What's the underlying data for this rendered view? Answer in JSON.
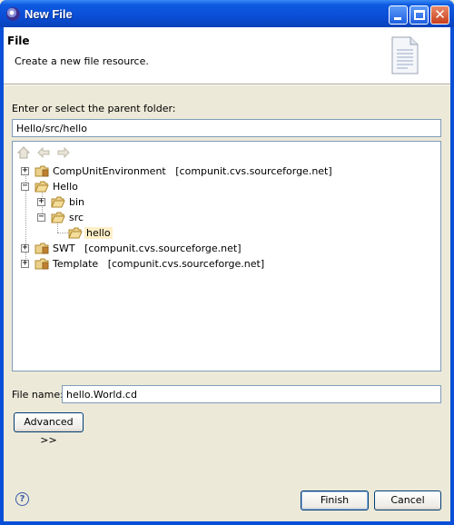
{
  "window": {
    "title": "New File"
  },
  "banner": {
    "title": "File",
    "description": "Create a new file resource."
  },
  "parent_folder": {
    "label": "Enter or select the parent folder:",
    "value": "Hello/src/hello"
  },
  "tree": [
    {
      "name": "CompUnitEnvironment",
      "repo": "[compunit.cvs.sourceforge.net]",
      "expanded": false,
      "type": "project"
    },
    {
      "name": "Hello",
      "repo": "",
      "expanded": true,
      "type": "project"
    },
    {
      "name": "bin",
      "repo": "",
      "expanded": false,
      "type": "folder"
    },
    {
      "name": "src",
      "repo": "",
      "expanded": true,
      "type": "folder"
    },
    {
      "name": "hello",
      "repo": "",
      "expanded": false,
      "type": "folder",
      "selected": true
    },
    {
      "name": "SWT",
      "repo": "[compunit.cvs.sourceforge.net]",
      "expanded": false,
      "type": "project"
    },
    {
      "name": "Template",
      "repo": "[compunit.cvs.sourceforge.net]",
      "expanded": false,
      "type": "project"
    }
  ],
  "file_name": {
    "label": "File name:",
    "value": "hello.World.cd"
  },
  "buttons": {
    "advanced": "Advanced >>",
    "finish": "Finish",
    "cancel": "Cancel",
    "help": "?"
  },
  "icons": {
    "home": "home-icon",
    "back": "back-arrow-icon",
    "forward": "forward-arrow-icon",
    "folder": "folder-icon",
    "project": "project-folder-icon",
    "help": "help-icon"
  },
  "colors": {
    "titlebar": "#0a4ed6",
    "selection": "#ffefc8",
    "dialog": "#ece9d8"
  }
}
